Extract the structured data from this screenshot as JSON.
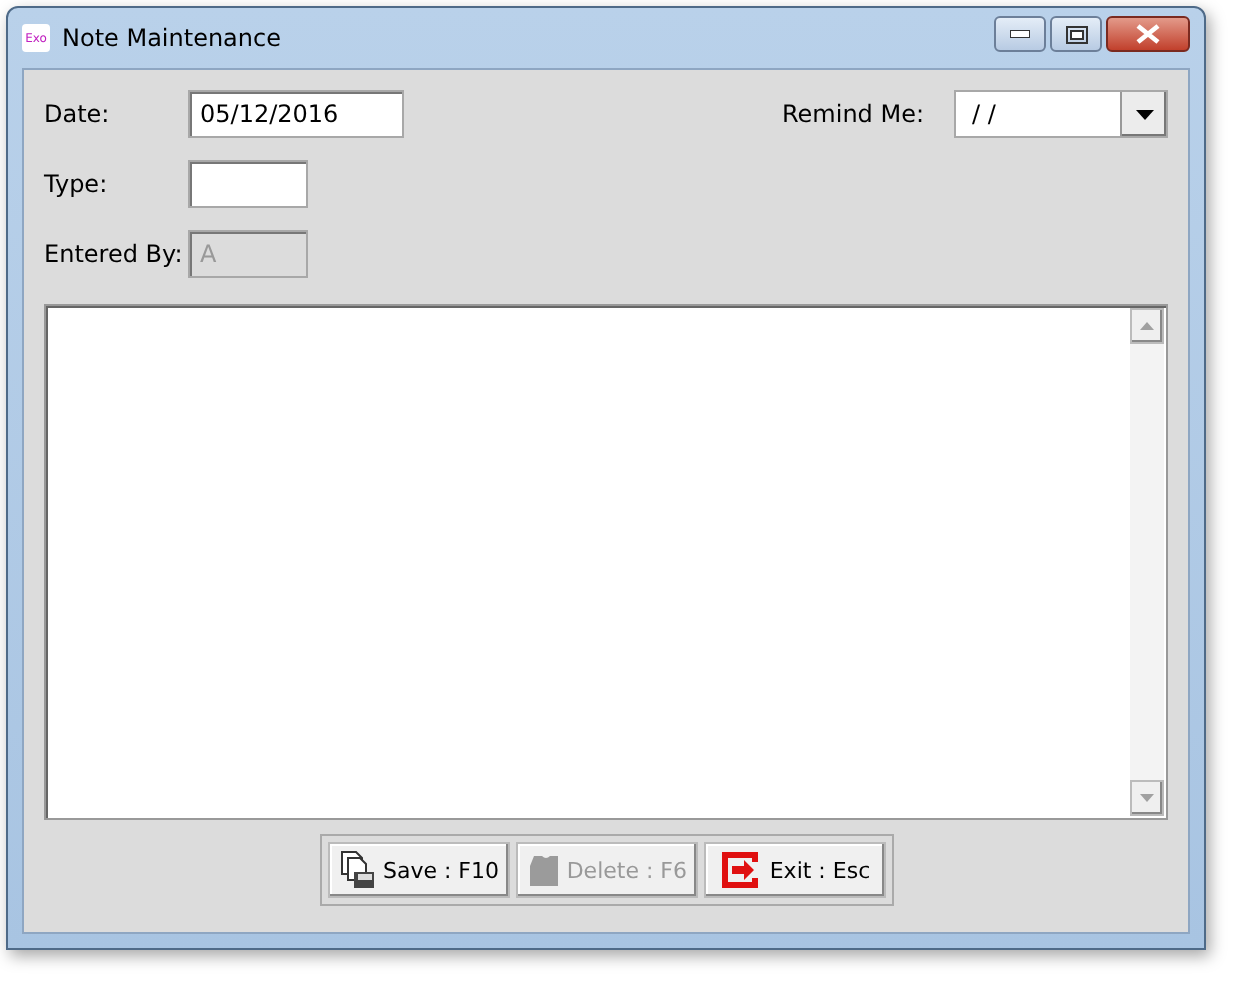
{
  "window": {
    "title": "Note Maintenance",
    "icon_text": "Exo"
  },
  "fields": [
    {
      "label": "Date:",
      "value": "05/12/2016",
      "kind": "text",
      "disabled": false
    },
    {
      "label": "Remind Me:",
      "value": "/ /",
      "kind": "dropdown",
      "disabled": false
    },
    {
      "label": "Type:",
      "kind": "text",
      "disabled": false
    },
    {
      "label": "Entered By:",
      "value": "A",
      "kind": "text",
      "disabled": true
    }
  ],
  "buttons": [
    {
      "label": "Save : F10",
      "kind": "save",
      "disabled": false
    },
    {
      "label": "Delete : F6",
      "kind": "delete",
      "disabled": true
    },
    {
      "label": "Exit : Esc",
      "kind": "exit",
      "disabled": false
    }
  ]
}
